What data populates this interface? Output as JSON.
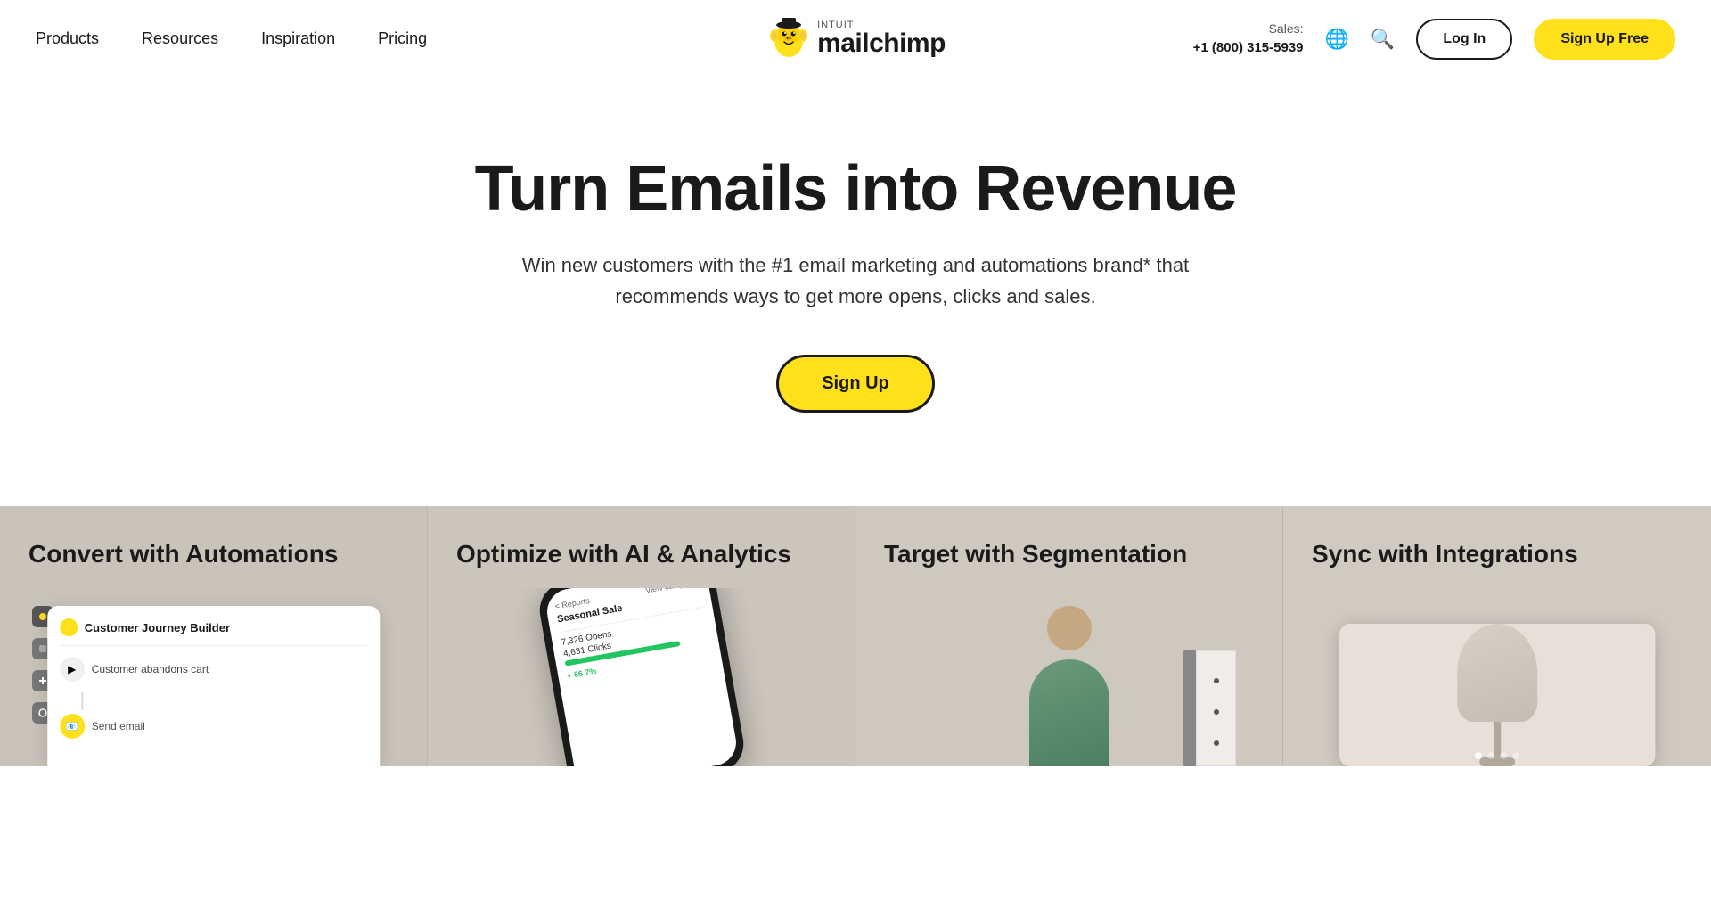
{
  "nav": {
    "products_label": "Products",
    "resources_label": "Resources",
    "inspiration_label": "Inspiration",
    "pricing_label": "Pricing",
    "logo_intuit": "INTUIT",
    "logo_mailchimp": "mailchimp",
    "sales_label": "Sales:",
    "sales_phone": "+1 (800) 315-5939",
    "login_label": "Log In",
    "signup_nav_label": "Sign Up Free"
  },
  "hero": {
    "title": "Turn Emails into Revenue",
    "subtitle": "Win new customers with the #1 email marketing and automations brand* that recommends ways to get more opens, clicks and sales.",
    "signup_label": "Sign Up"
  },
  "features": [
    {
      "title": "Convert with Automations",
      "mockup_title": "Customer Journey Builder",
      "mockup_row": "Customer abandons cart"
    },
    {
      "title": "Optimize with AI & Analytics",
      "phone_header": "< Reports",
      "phone_campaign": "View campaign",
      "phone_title": "Seasonal Sale",
      "phone_opens_label": "7,326 Opens",
      "phone_clicks_label": "4,631 Clicks",
      "phone_badge": "+ 66.7%"
    },
    {
      "title": "Target with Segmentation"
    },
    {
      "title": "Sync with Integrations"
    }
  ],
  "icons": {
    "globe": "🌐",
    "search": "🔍"
  }
}
